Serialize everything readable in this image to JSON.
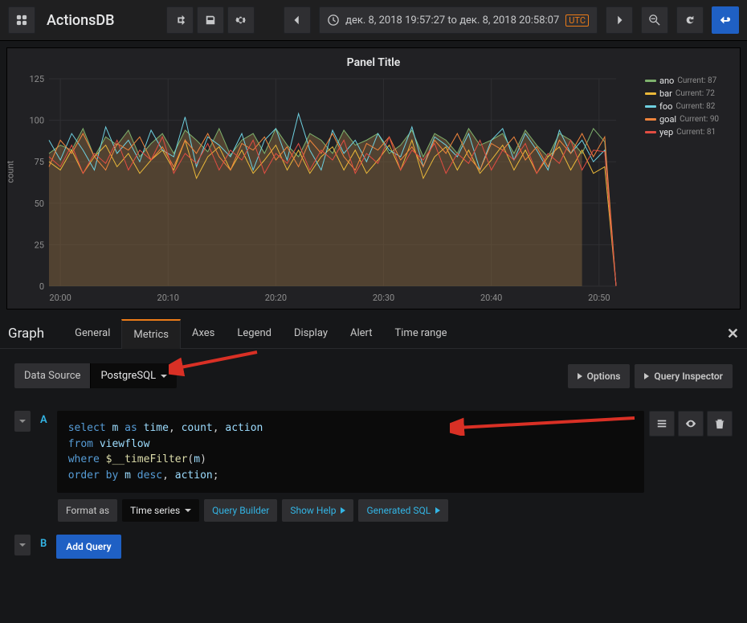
{
  "header": {
    "dashboard_title": "ActionsDB",
    "time_range_text": "дек. 8, 2018 19:57:27 to дек. 8, 2018 20:58:07",
    "utc_badge": "UTC"
  },
  "panel": {
    "title": "Panel Title",
    "yaxis_label": "count"
  },
  "chart_data": {
    "type": "line",
    "xlabel": "",
    "ylabel": "count",
    "ylim": [
      0,
      125
    ],
    "x_ticks": [
      "20:00",
      "20:10",
      "20:20",
      "20:30",
      "20:40",
      "20:50"
    ],
    "y_ticks": [
      0,
      25,
      50,
      75,
      100,
      125
    ],
    "series": [
      {
        "name": "ano",
        "color": "#7eb26d",
        "current": 87,
        "values": [
          80,
          85,
          82,
          95,
          78,
          90,
          85,
          94,
          78,
          86,
          92,
          80,
          94,
          88,
          81,
          95,
          79,
          88,
          92,
          80,
          95,
          85,
          78,
          92,
          88,
          80,
          94,
          85,
          88,
          92,
          80,
          85,
          94,
          78,
          92,
          88,
          80,
          95,
          85,
          88,
          92,
          80,
          94,
          85,
          78,
          92,
          88,
          80,
          95,
          87,
          0
        ]
      },
      {
        "name": "bar",
        "color": "#eab839",
        "current": 72,
        "values": [
          75,
          70,
          82,
          68,
          78,
          85,
          72,
          80,
          68,
          76,
          82,
          70,
          88,
          65,
          78,
          84,
          70,
          82,
          68,
          76,
          85,
          70,
          82,
          68,
          78,
          84,
          70,
          82,
          68,
          76,
          85,
          70,
          88,
          65,
          78,
          84,
          70,
          82,
          68,
          76,
          85,
          70,
          82,
          68,
          78,
          84,
          70,
          82,
          68,
          72,
          0
        ]
      },
      {
        "name": "foo",
        "color": "#6ed0e0",
        "current": 82,
        "values": [
          88,
          76,
          92,
          82,
          70,
          96,
          80,
          88,
          75,
          94,
          82,
          78,
          102,
          72,
          90,
          85,
          78,
          92,
          70,
          88,
          95,
          76,
          104,
          82,
          70,
          94,
          80,
          88,
          75,
          92,
          82,
          78,
          96,
          72,
          90,
          85,
          78,
          92,
          70,
          88,
          95,
          76,
          92,
          82,
          70,
          94,
          80,
          88,
          75,
          82,
          0
        ]
      },
      {
        "name": "goal",
        "color": "#ef843c",
        "current": 90,
        "values": [
          72,
          88,
          80,
          92,
          78,
          70,
          86,
          82,
          90,
          76,
          84,
          72,
          88,
          80,
          92,
          78,
          70,
          86,
          82,
          90,
          76,
          84,
          72,
          88,
          80,
          92,
          78,
          70,
          86,
          82,
          90,
          76,
          84,
          72,
          88,
          80,
          92,
          78,
          70,
          86,
          82,
          90,
          76,
          84,
          72,
          88,
          80,
          92,
          78,
          90,
          0
        ]
      },
      {
        "name": "yep",
        "color": "#e24d42",
        "current": 81,
        "values": [
          78,
          72,
          85,
          68,
          80,
          74,
          88,
          70,
          82,
          76,
          90,
          68,
          80,
          74,
          86,
          70,
          82,
          76,
          88,
          68,
          80,
          74,
          86,
          70,
          82,
          76,
          88,
          68,
          80,
          74,
          90,
          70,
          82,
          76,
          86,
          68,
          80,
          74,
          88,
          70,
          82,
          76,
          86,
          68,
          80,
          74,
          88,
          70,
          82,
          81,
          0
        ]
      }
    ]
  },
  "editor": {
    "panel_type": "Graph",
    "tabs": [
      "General",
      "Metrics",
      "Axes",
      "Legend",
      "Display",
      "Alert",
      "Time range"
    ],
    "active_tab": "Metrics",
    "data_source_label": "Data Source",
    "data_source_value": "PostgreSQL",
    "options_btn": "Options",
    "inspector_btn": "Query Inspector",
    "query_a_letter": "A",
    "query_b_letter": "B",
    "format_label": "Format as",
    "format_value": "Time series",
    "query_builder_btn": "Query Builder",
    "show_help_btn": "Show Help",
    "generated_sql_btn": "Generated SQL",
    "add_query_btn": "Add Query",
    "sql": {
      "line1_kw1": "select",
      "line1_id1": "m",
      "line1_kw2": "as",
      "line1_id2": "time",
      "line1_id3": "count",
      "line1_id4": "action",
      "line2_kw": "from",
      "line2_id": "viewflow",
      "line3_kw": "where",
      "line3_fn": "$__timeFilter",
      "line3_arg": "m",
      "line4_kw1": "order",
      "line4_kw2": "by",
      "line4_id1": "m",
      "line4_kw3": "desc",
      "line4_id2": "action"
    }
  }
}
